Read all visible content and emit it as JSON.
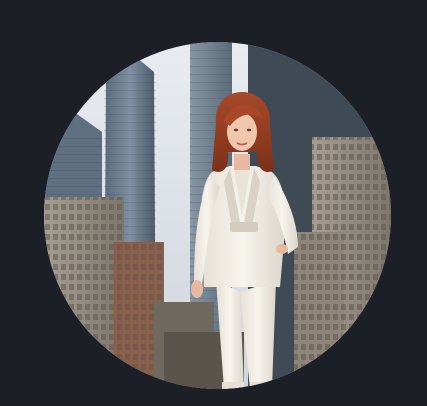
{
  "avatar": {
    "image_subject": "woman-in-white-suit-city-skyline",
    "colors": {
      "page_background": "#1c1f26",
      "suit": "#f2eee6",
      "hair": "#b4542c",
      "sky": "#dfe4ea"
    }
  }
}
